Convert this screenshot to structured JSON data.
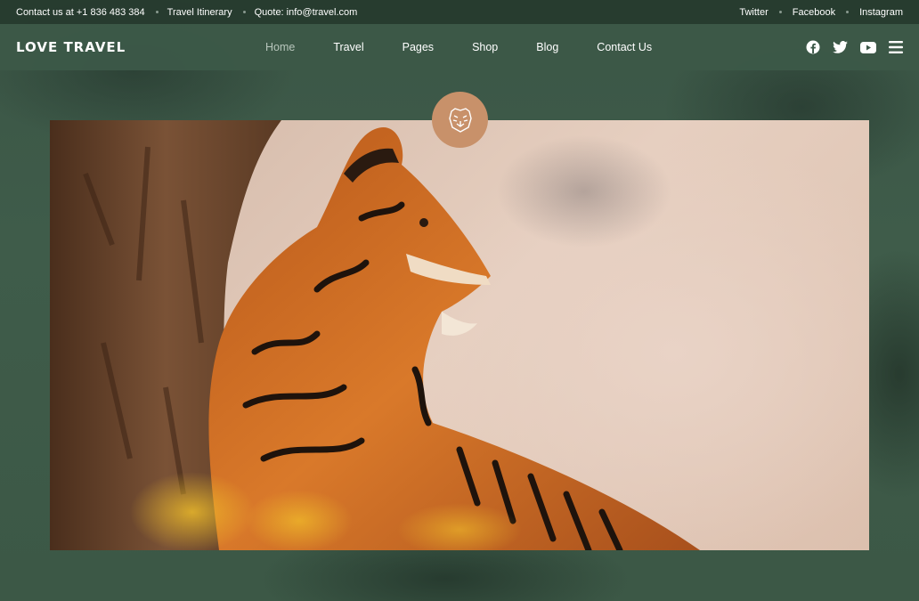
{
  "topbar": {
    "contact": "Contact us at +1 836 483 384",
    "itinerary": "Travel Itinerary",
    "quote": "Quote: info@travel.com",
    "social": [
      "Twitter",
      "Facebook",
      "Instagram"
    ]
  },
  "nav": {
    "logo": "LOVE TRAVEL",
    "items": [
      "Home",
      "Travel",
      "Pages",
      "Shop",
      "Blog",
      "Contact Us"
    ],
    "active": "Home",
    "icons": [
      "facebook-icon",
      "twitter-icon",
      "youtube-icon",
      "menu-icon"
    ]
  },
  "hero": {
    "image": "tiger-photo",
    "badge_icon": "tiger-head-icon"
  },
  "colors": {
    "background": "#3e5a48",
    "badge": "#c8916a"
  }
}
